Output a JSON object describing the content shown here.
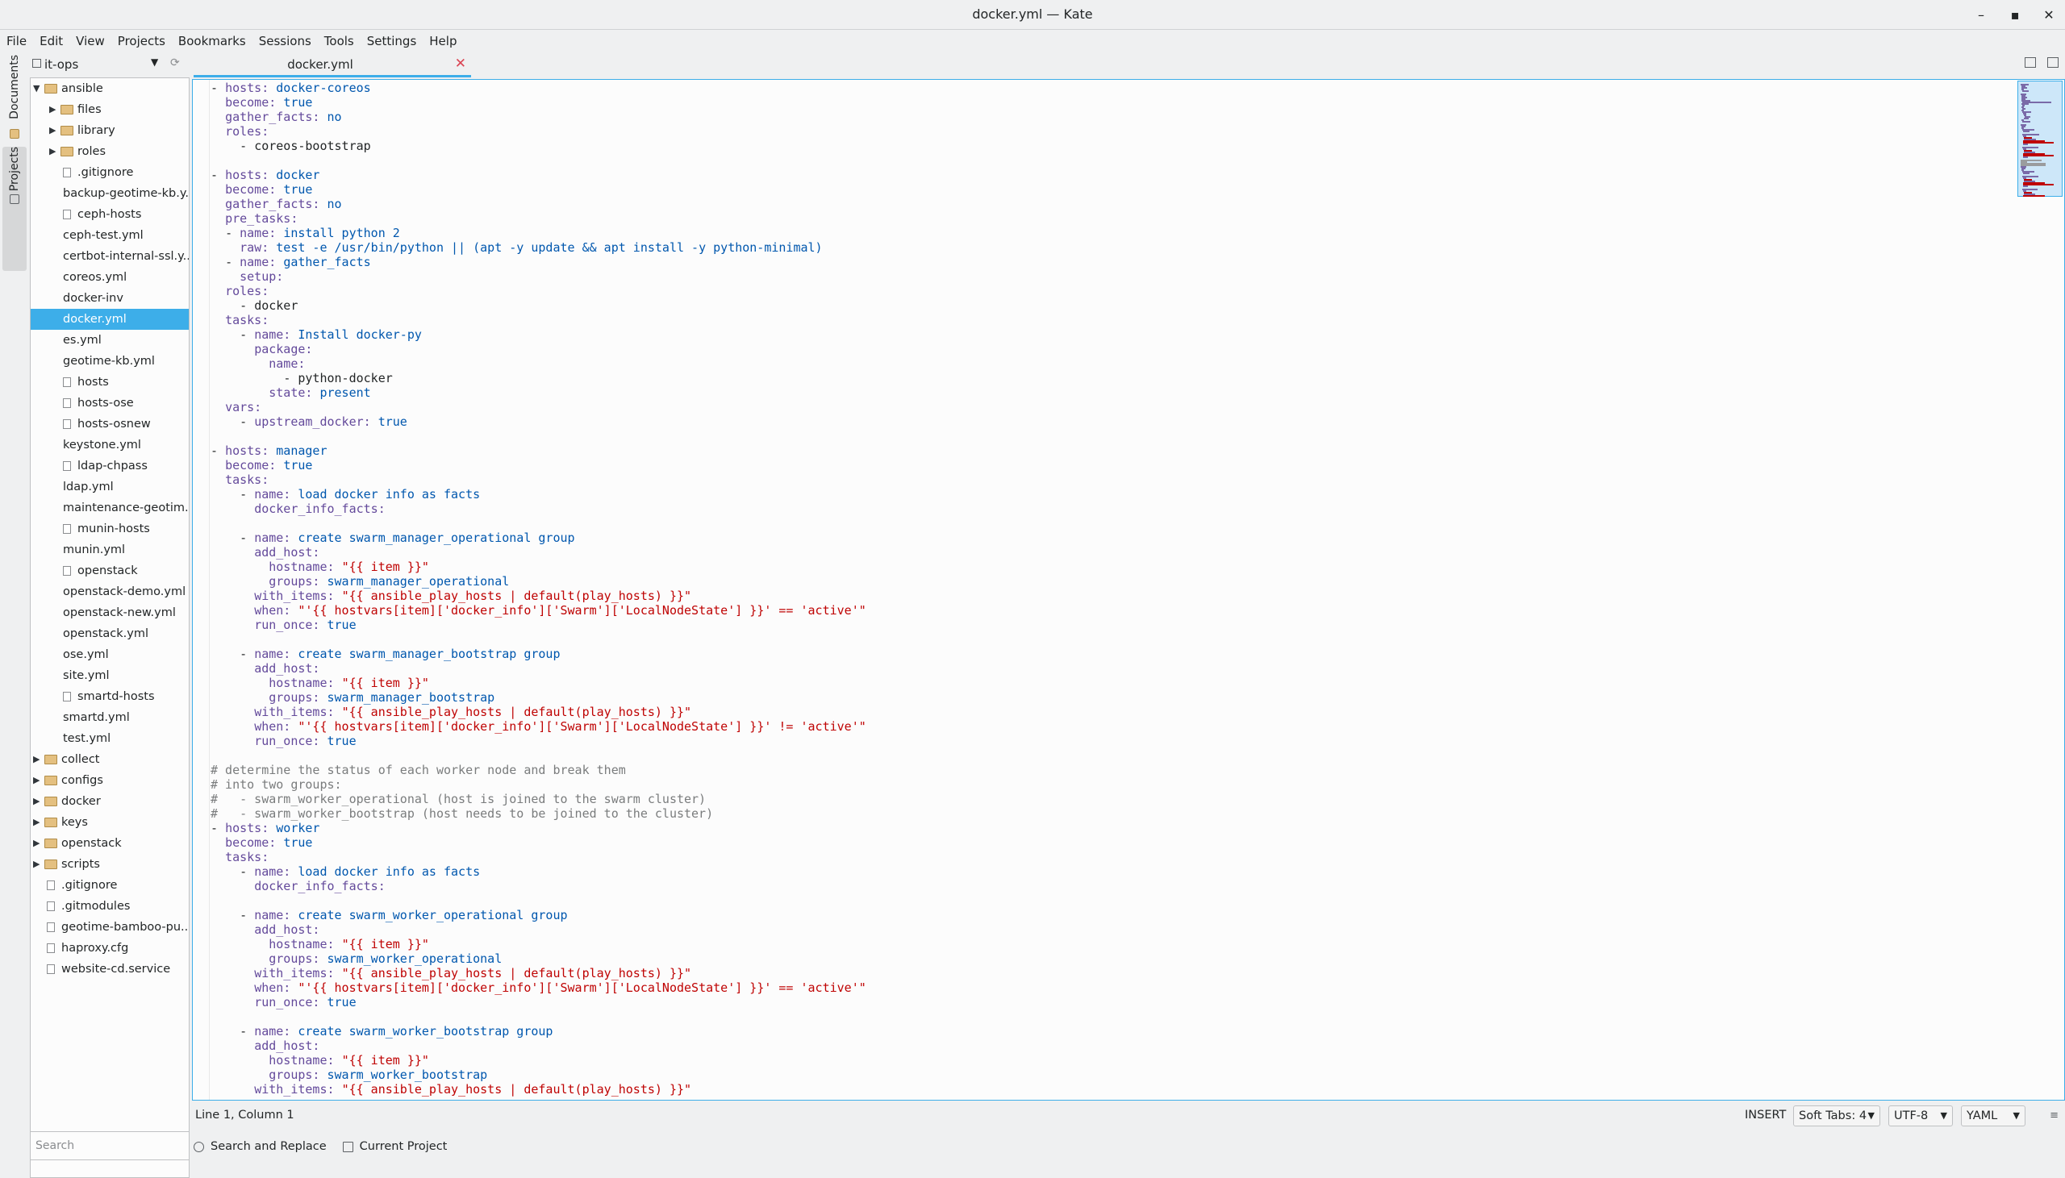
{
  "window": {
    "title": "docker.yml — Kate",
    "buttons": [
      "–",
      "▪",
      "✕"
    ]
  },
  "menu": [
    "File",
    "Edit",
    "View",
    "Projects",
    "Bookmarks",
    "Sessions",
    "Tools",
    "Settings",
    "Help"
  ],
  "sidebar_tabs": {
    "documents": "Documents",
    "projects": "Projects"
  },
  "project": {
    "name": "it-ops"
  },
  "tree": [
    {
      "label": "ansible",
      "depth": 0,
      "type": "folder",
      "expanded": true
    },
    {
      "label": "files",
      "depth": 1,
      "type": "folder"
    },
    {
      "label": "library",
      "depth": 1,
      "type": "folder"
    },
    {
      "label": "roles",
      "depth": 1,
      "type": "folder"
    },
    {
      "label": ".gitignore",
      "depth": 1,
      "type": "textfile"
    },
    {
      "label": "backup-geotime-kb.y...",
      "depth": 1,
      "type": "file"
    },
    {
      "label": "ceph-hosts",
      "depth": 1,
      "type": "textfile"
    },
    {
      "label": "ceph-test.yml",
      "depth": 1,
      "type": "file"
    },
    {
      "label": "certbot-internal-ssl.y...",
      "depth": 1,
      "type": "file"
    },
    {
      "label": "coreos.yml",
      "depth": 1,
      "type": "file"
    },
    {
      "label": "docker-inv",
      "depth": 1,
      "type": "file"
    },
    {
      "label": "docker.yml",
      "depth": 1,
      "type": "file",
      "selected": true
    },
    {
      "label": "es.yml",
      "depth": 1,
      "type": "file"
    },
    {
      "label": "geotime-kb.yml",
      "depth": 1,
      "type": "file"
    },
    {
      "label": "hosts",
      "depth": 1,
      "type": "textfile"
    },
    {
      "label": "hosts-ose",
      "depth": 1,
      "type": "textfile"
    },
    {
      "label": "hosts-osnew",
      "depth": 1,
      "type": "textfile"
    },
    {
      "label": "keystone.yml",
      "depth": 1,
      "type": "file"
    },
    {
      "label": "ldap-chpass",
      "depth": 1,
      "type": "textfile"
    },
    {
      "label": "ldap.yml",
      "depth": 1,
      "type": "file"
    },
    {
      "label": "maintenance-geotim...",
      "depth": 1,
      "type": "file"
    },
    {
      "label": "munin-hosts",
      "depth": 1,
      "type": "textfile"
    },
    {
      "label": "munin.yml",
      "depth": 1,
      "type": "file"
    },
    {
      "label": "openstack",
      "depth": 1,
      "type": "textfile"
    },
    {
      "label": "openstack-demo.yml",
      "depth": 1,
      "type": "file"
    },
    {
      "label": "openstack-new.yml",
      "depth": 1,
      "type": "file"
    },
    {
      "label": "openstack.yml",
      "depth": 1,
      "type": "file"
    },
    {
      "label": "ose.yml",
      "depth": 1,
      "type": "file"
    },
    {
      "label": "site.yml",
      "depth": 1,
      "type": "file"
    },
    {
      "label": "smartd-hosts",
      "depth": 1,
      "type": "textfile"
    },
    {
      "label": "smartd.yml",
      "depth": 1,
      "type": "file"
    },
    {
      "label": "test.yml",
      "depth": 1,
      "type": "file"
    },
    {
      "label": "collect",
      "depth": 0,
      "type": "folder"
    },
    {
      "label": "configs",
      "depth": 0,
      "type": "folder"
    },
    {
      "label": "docker",
      "depth": 0,
      "type": "folder"
    },
    {
      "label": "keys",
      "depth": 0,
      "type": "folder"
    },
    {
      "label": "openstack",
      "depth": 0,
      "type": "folder"
    },
    {
      "label": "scripts",
      "depth": 0,
      "type": "folder"
    },
    {
      "label": ".gitignore",
      "depth": 0,
      "type": "textfile"
    },
    {
      "label": ".gitmodules",
      "depth": 0,
      "type": "textfile"
    },
    {
      "label": "geotime-bamboo-pu...",
      "depth": 0,
      "type": "textfile"
    },
    {
      "label": "haproxy.cfg",
      "depth": 0,
      "type": "textfile"
    },
    {
      "label": "website-cd.service",
      "depth": 0,
      "type": "textfile"
    }
  ],
  "search": {
    "placeholder": "Search"
  },
  "editor_tab": {
    "name": "docker.yml",
    "close": "✕"
  },
  "code_lines": [
    "- hosts: docker-coreos",
    "  become: true",
    "  gather_facts: no",
    "  roles:",
    "    - coreos-bootstrap",
    "",
    "- hosts: docker",
    "  become: true",
    "  gather_facts: no",
    "  pre_tasks:",
    "  - name: install python 2",
    "    raw: test -e /usr/bin/python || (apt -y update && apt install -y python-minimal)",
    "  - name: gather_facts",
    "    setup:",
    "  roles:",
    "    - docker",
    "  tasks:",
    "    - name: Install docker-py",
    "      package:",
    "        name:",
    "          - python-docker",
    "        state: present",
    "  vars:",
    "    - upstream_docker: true",
    "",
    "- hosts: manager",
    "  become: true",
    "  tasks:",
    "    - name: load docker info as facts",
    "      docker_info_facts:",
    "",
    "    - name: create swarm_manager_operational group",
    "      add_host:",
    "        hostname: \"{{ item }}\"",
    "        groups: swarm_manager_operational",
    "      with_items: \"{{ ansible_play_hosts | default(play_hosts) }}\"",
    "      when: \"'{{ hostvars[item]['docker_info']['Swarm']['LocalNodeState'] }}' == 'active'\"",
    "      run_once: true",
    "",
    "    - name: create swarm_manager_bootstrap group",
    "      add_host:",
    "        hostname: \"{{ item }}\"",
    "        groups: swarm_manager_bootstrap",
    "      with_items: \"{{ ansible_play_hosts | default(play_hosts) }}\"",
    "      when: \"'{{ hostvars[item]['docker_info']['Swarm']['LocalNodeState'] }}' != 'active'\"",
    "      run_once: true",
    "",
    "# determine the status of each worker node and break them",
    "# into two groups:",
    "#   - swarm_worker_operational (host is joined to the swarm cluster)",
    "#   - swarm_worker_bootstrap (host needs to be joined to the cluster)",
    "- hosts: worker",
    "  become: true",
    "  tasks:",
    "    - name: load docker info as facts",
    "      docker_info_facts:",
    "",
    "    - name: create swarm_worker_operational group",
    "      add_host:",
    "        hostname: \"{{ item }}\"",
    "        groups: swarm_worker_operational",
    "      with_items: \"{{ ansible_play_hosts | default(play_hosts) }}\"",
    "      when: \"'{{ hostvars[item]['docker_info']['Swarm']['LocalNodeState'] }}' == 'active'\"",
    "      run_once: true",
    "",
    "    - name: create swarm_worker_bootstrap group",
    "      add_host:",
    "        hostname: \"{{ item }}\"",
    "        groups: swarm_worker_bootstrap",
    "      with_items: \"{{ ansible_play_hosts | default(play_hosts) }}\""
  ],
  "syntax_colors": {
    "keyword": "#644a9b",
    "value": "#0057ae",
    "string": "#bf0303",
    "comment": "#7a7c7d",
    "accent": "#3daee9"
  },
  "status": {
    "position": "Line 1, Column 1",
    "mode": "INSERT",
    "indent": "Soft Tabs: 4",
    "encoding": "UTF-8",
    "syntax": "YAML"
  },
  "bottom_tabs": [
    "Search and Replace",
    "Current Project"
  ]
}
